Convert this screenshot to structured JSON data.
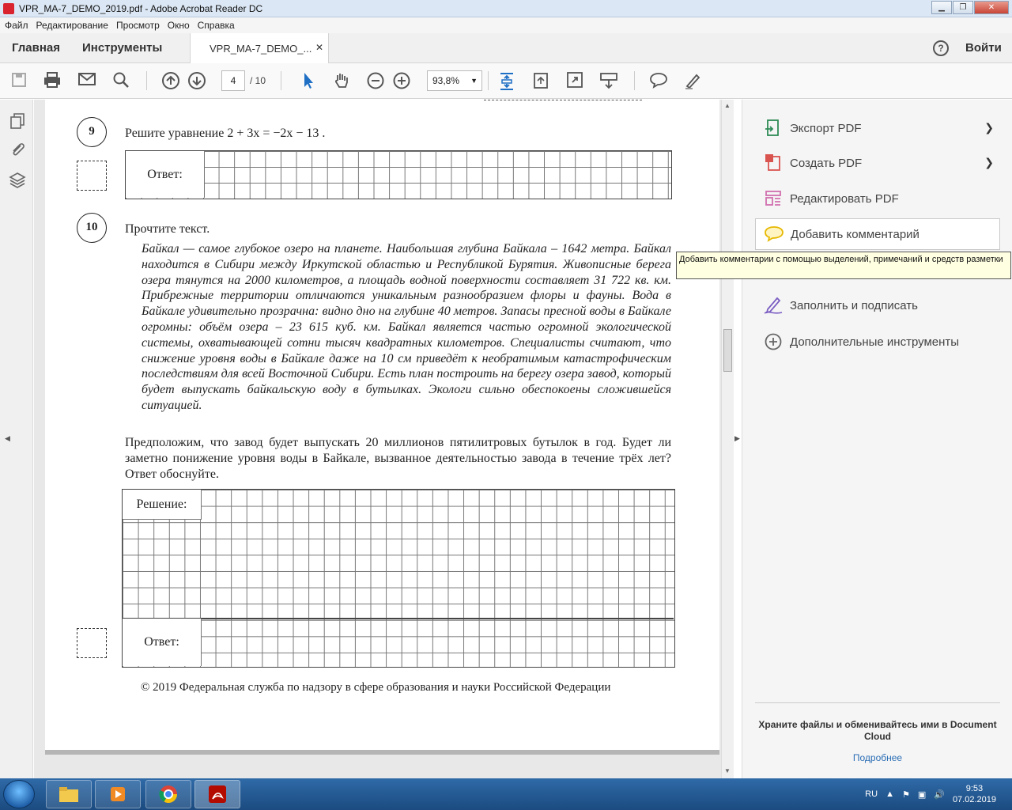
{
  "window": {
    "title": "VPR_MA-7_DEMO_2019.pdf - Adobe Acrobat Reader DC"
  },
  "menu": [
    "Файл",
    "Редактирование",
    "Просмотр",
    "Окно",
    "Справка"
  ],
  "tabs": {
    "home": "Главная",
    "tools": "Инструменты",
    "document": "VPR_MA-7_DEMO_...",
    "signin": "Войти"
  },
  "toolbar": {
    "page_current": "4",
    "page_total": "/ 10",
    "zoom": "93,8%"
  },
  "document": {
    "q9": {
      "number": "9",
      "prompt": "Решите уравнение  2 + 3x = −2x − 13 .",
      "answer_label": "Ответ:"
    },
    "q10": {
      "number": "10",
      "intro": "Прочтите текст.",
      "text": "Байкал — самое глубокое озеро на планете. Наибольшая глубина Байкала – 1642 метра. Байкал находится в Сибири между Иркутской областью и Республикой Бурятия. Живописные берега озера тянутся на 2000 километров, а площадь водной поверхности составляет 31 722 кв. км. Прибрежные территории отличаются уникальным разнообразием флоры и фауны. Вода в Байкале удивительно прозрачна: видно дно на глубине 40 метров. Запасы пресной воды в Байкале огромны: объём озера – 23 615 куб. км. Байкал является частью огромной экологической системы, охватывающей сотни тысяч квадратных километров. Специалисты считают, что снижение уровня воды в Байкале даже на 10 см приведёт к необратимым катастрофическим последствиям для всей Восточной Сибири. Есть план построить на берегу озера завод, который будет выпускать байкальскую воду в бутылках. Экологи сильно обеспокоены сложившейся ситуацией.",
      "question": "Предположим, что завод будет выпускать 20 миллионов пятилитровых бутылок в год. Будет ли заметно понижение уровня воды в Байкале, вызванное деятельностью завода в течение трёх лет? Ответ обоснуйте.",
      "solution_label": "Решение:",
      "answer_label": "Ответ:"
    },
    "footer": "© 2019 Федеральная служба по надзору в сфере образования и науки Российской Федерации"
  },
  "right_panel": {
    "items": [
      {
        "label": "Экспорт PDF",
        "icon": "export-pdf-icon",
        "color": "#2e8b57"
      },
      {
        "label": "Создать PDF",
        "icon": "create-pdf-icon",
        "color": "#d9534f"
      },
      {
        "label": "Редактировать PDF",
        "icon": "edit-pdf-icon",
        "color": "#d16fae"
      },
      {
        "label": "Добавить комментарий",
        "icon": "comment-icon",
        "color": "#e6b800"
      },
      {
        "label": "Заполнить и подписать",
        "icon": "fill-sign-icon",
        "color": "#7a5cc2"
      },
      {
        "label": "Дополнительные инструменты",
        "icon": "more-tools-icon",
        "color": "#666666"
      }
    ],
    "tooltip": "Добавить комментарии с помощью выделений, примечаний и средств разметки",
    "cloud_text": "Храните файлы и обменивайтесь ими в Document Cloud",
    "cloud_link": "Подробнее"
  },
  "taskbar": {
    "lang": "RU",
    "time": "9:53",
    "date": "07.02.2019"
  }
}
